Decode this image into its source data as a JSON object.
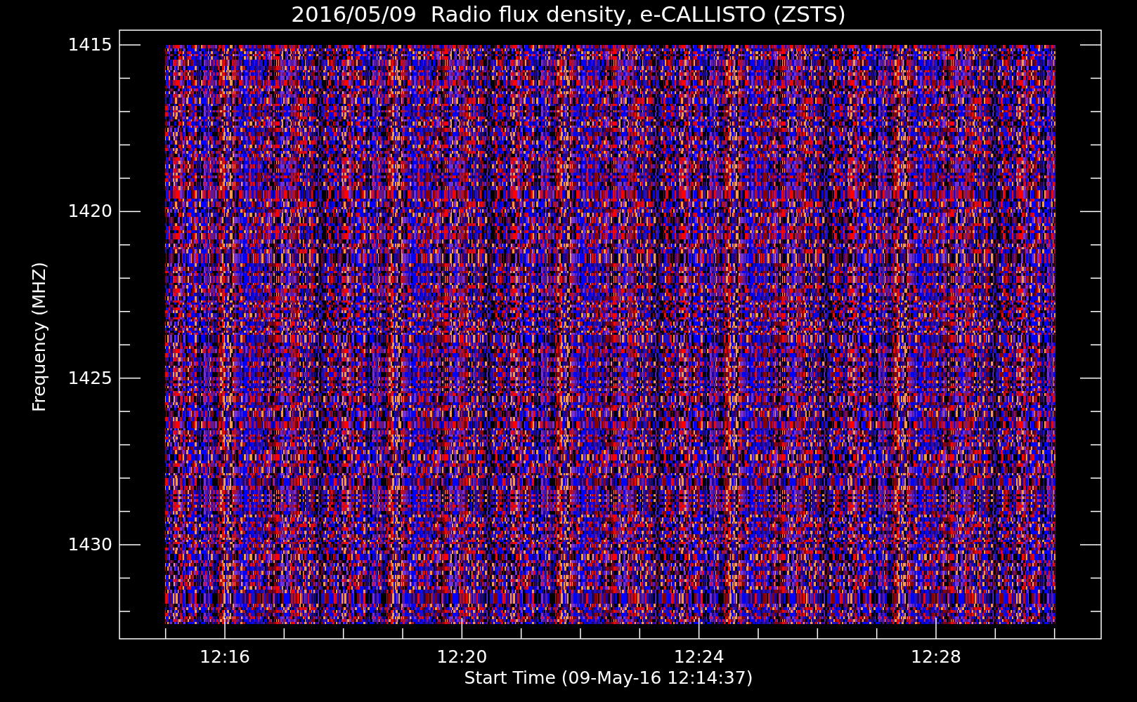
{
  "title": "2016/05/09  Radio flux density, e-CALLISTO (ZSTS)",
  "ylabel": "Frequency (MHZ)",
  "xlabel": "Start Time (09-May-16 12:14:37)",
  "yticks": [
    "1415",
    "1420",
    "1425",
    "1430"
  ],
  "xticks": [
    "12:16",
    "12:20",
    "12:24",
    "12:28"
  ]
}
